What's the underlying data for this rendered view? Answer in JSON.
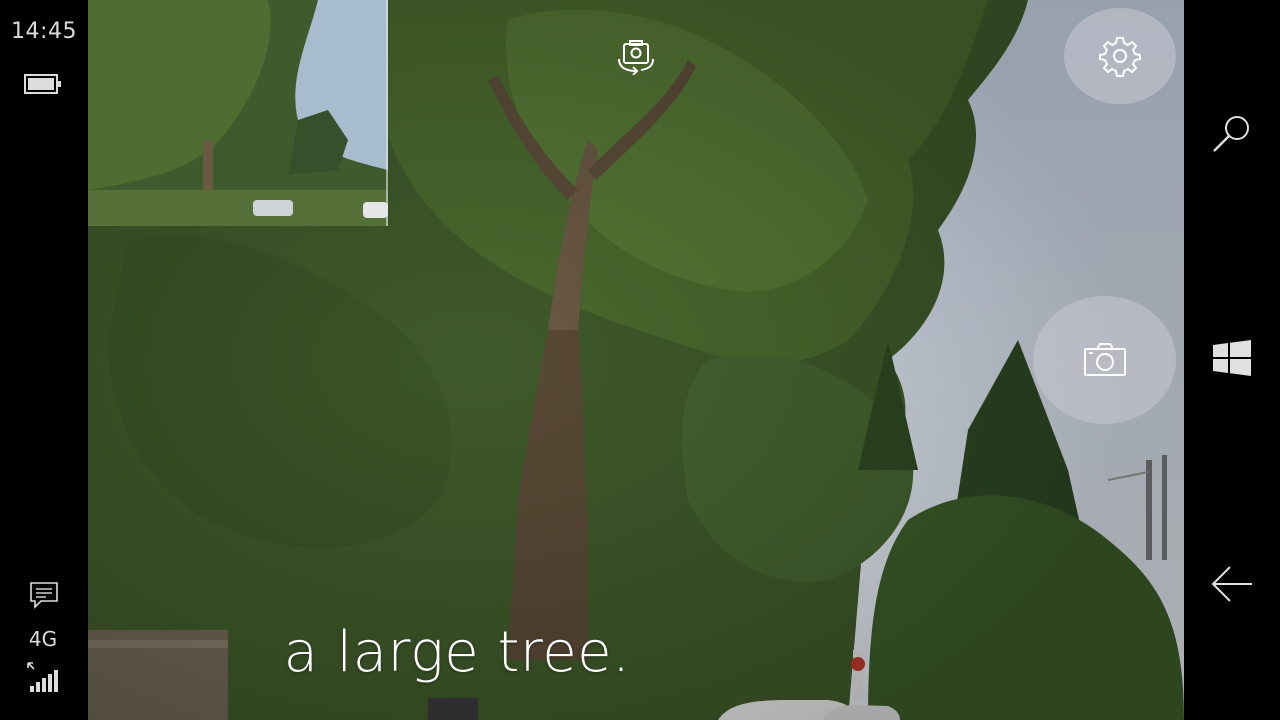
{
  "status_bar": {
    "time": "14:45",
    "battery_icon": "battery-full-icon",
    "notification_icon": "message-icon",
    "network_type": "4G",
    "signal_icon": "signal-strength-icon"
  },
  "camera": {
    "caption": "a large tree.",
    "controls": {
      "switch_camera_icon": "switch-camera-icon",
      "settings_icon": "gear-icon",
      "shutter_icon": "camera-icon"
    }
  },
  "nav_bar": {
    "search_icon": "search-icon",
    "start_icon": "windows-logo-icon",
    "back_icon": "back-arrow-icon"
  },
  "colors": {
    "background": "#000000",
    "status_text": "#dcdcdc",
    "button_overlay": "#c8c8d2",
    "caption_text": "#ffffff"
  }
}
